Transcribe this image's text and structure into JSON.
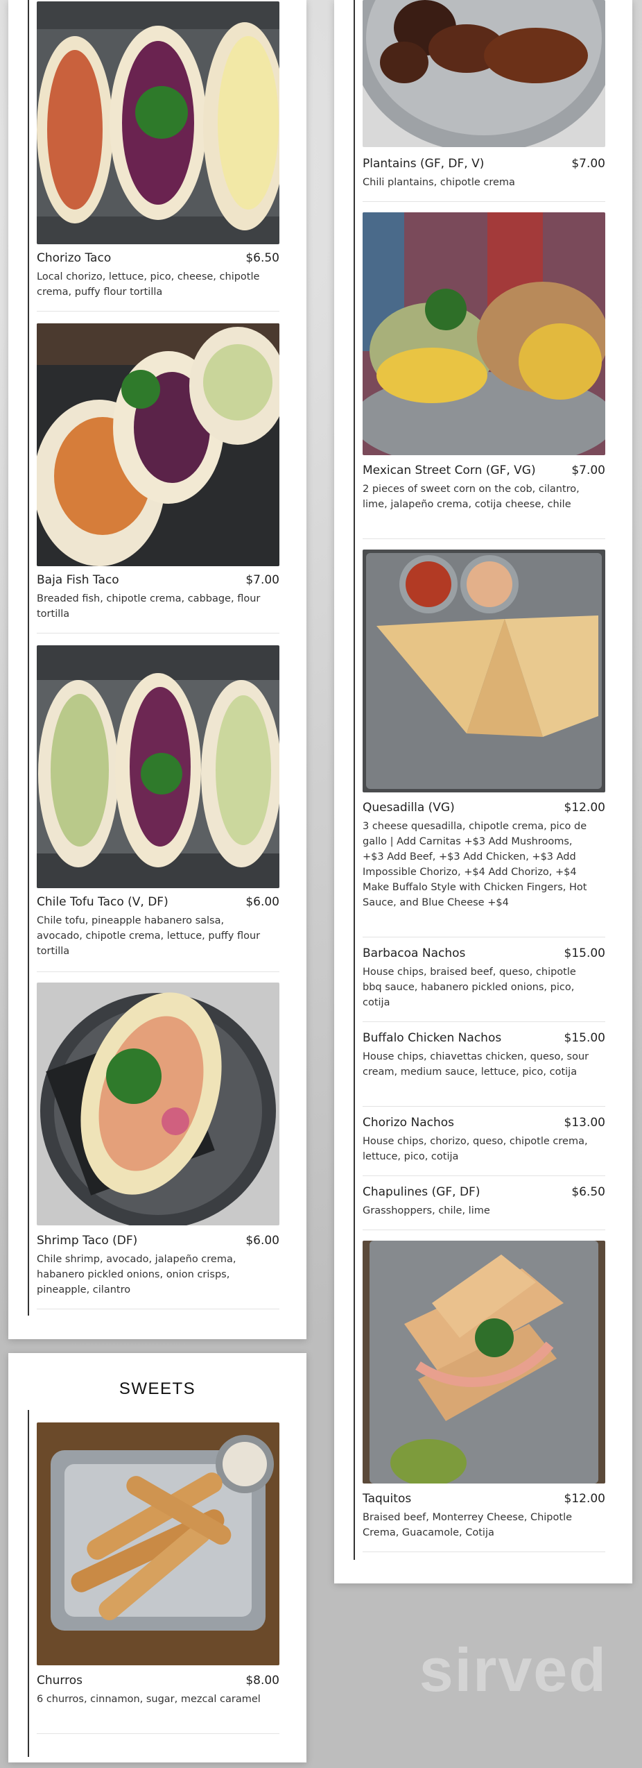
{
  "left_items": [
    {
      "name": "Chorizo Taco",
      "price": "$6.50",
      "desc": "Local chorizo, lettuce, pico, cheese, chipotle crema, puffy flour tortilla"
    },
    {
      "name": "Baja Fish Taco",
      "price": "$7.00",
      "desc": "Breaded fish, chipotle crema, cabbage, flour tortilla"
    },
    {
      "name": "Chile Tofu Taco (V, DF)",
      "price": "$6.00",
      "desc": "Chile tofu, pineapple habanero salsa, avocado, chipotle crema, lettuce, puffy flour tortilla"
    },
    {
      "name": "Shrimp Taco (DF)",
      "price": "$6.00",
      "desc": "Chile shrimp, avocado, jalapeño crema, habanero pickled onions, onion crisps, pineapple, cilantro"
    }
  ],
  "sweets": {
    "title": "SWEETS",
    "items": [
      {
        "name": "Churros",
        "price": "$8.00",
        "desc": "6 churros, cinnamon, sugar, mezcal caramel"
      }
    ]
  },
  "right_items": [
    {
      "name": "Plantains (GF, DF, V)",
      "price": "$7.00",
      "desc": "Chili plantains, chipotle crema"
    },
    {
      "name": "Mexican Street Corn (GF, VG)",
      "price": "$7.00",
      "desc": "2 pieces of sweet corn on the cob, cilantro, lime, jalapeño crema, cotija cheese, chile"
    },
    {
      "name": "Quesadilla (VG)",
      "price": "$12.00",
      "desc": "3 cheese quesadilla, chipotle crema, pico de gallo | Add Carnitas +$3 Add Mushrooms, +$3 Add Beef, +$3 Add Chicken, +$3 Add Impossible Chorizo, +$4 Add Chorizo, +$4 Make Buffalo Style with Chicken Fingers, Hot Sauce, and Blue Cheese +$4"
    },
    {
      "name": "Barbacoa Nachos",
      "price": "$15.00",
      "desc": "House chips, braised beef, queso, chipotle bbq sauce, habanero pickled onions, pico, cotija"
    },
    {
      "name": "Buffalo Chicken Nachos",
      "price": "$15.00",
      "desc": "House chips, chiavettas chicken, queso, sour cream, medium sauce, lettuce, pico, cotija"
    },
    {
      "name": "Chorizo Nachos",
      "price": "$13.00",
      "desc": "House chips, chorizo, queso, chipotle crema, lettuce, pico, cotija"
    },
    {
      "name": "Chapulines (GF, DF)",
      "price": "$6.50",
      "desc": "Grasshoppers, chile, lime"
    },
    {
      "name": "Taquitos",
      "price": "$12.00",
      "desc": "Braised beef, Monterrey Cheese, Chipotle Crema, Guacamole, Cotija"
    }
  ],
  "watermark": "sirved",
  "colors": {
    "card": "#ffffff",
    "background": "#cfcfcf",
    "rule": "#333333"
  },
  "photo_icons": [
    "taco-photo",
    "fish-taco-photo",
    "tofu-taco-photo",
    "shrimp-taco-photo",
    "churros-photo",
    "plantains-photo",
    "corn-photo",
    "quesadilla-photo",
    "taquitos-photo"
  ]
}
